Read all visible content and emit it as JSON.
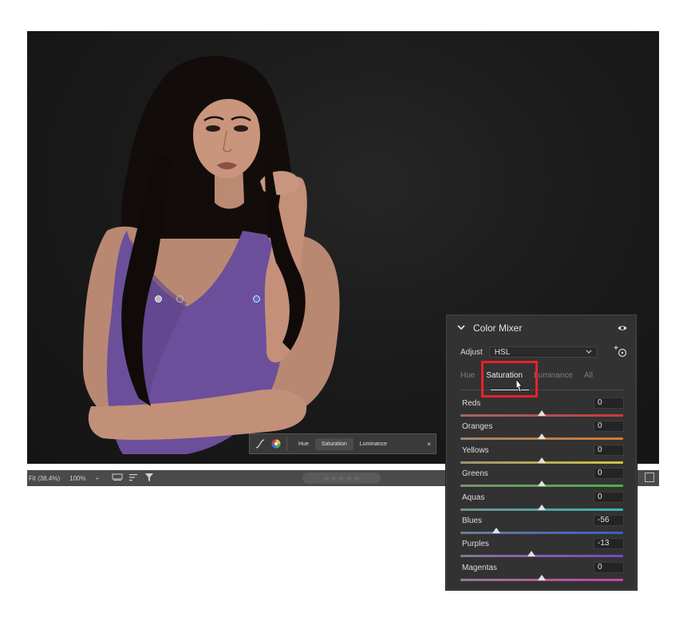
{
  "mini_toolbar": {
    "tabs": [
      "Hue",
      "Saturation",
      "Luminance"
    ],
    "active_tab": "Saturation",
    "close": "×"
  },
  "bottom_bar": {
    "fit": "Fit (38.4%)",
    "zoom": "100%",
    "zoom_sep": "÷",
    "stars": "☆ ☆ ☆ ☆ ☆"
  },
  "panel": {
    "title": "Color Mixer",
    "adjust_label": "Adjust",
    "adjust_value": "HSL",
    "tabs": [
      "Hue",
      "Saturation",
      "Luminance",
      "All"
    ],
    "active_tab": "Saturation",
    "sliders": [
      {
        "label": "Reds",
        "value": "0",
        "fraction": 0.5,
        "track_colors": [
          "#9e6a6a",
          "#c43b3b"
        ]
      },
      {
        "label": "Oranges",
        "value": "0",
        "fraction": 0.5,
        "track_colors": [
          "#9c8470",
          "#d07a33"
        ]
      },
      {
        "label": "Yellows",
        "value": "0",
        "fraction": 0.5,
        "track_colors": [
          "#9a9470",
          "#cfc23d"
        ]
      },
      {
        "label": "Greens",
        "value": "0",
        "fraction": 0.5,
        "track_colors": [
          "#7a8f75",
          "#4caf45"
        ]
      },
      {
        "label": "Aquas",
        "value": "0",
        "fraction": 0.5,
        "track_colors": [
          "#72908e",
          "#3cb3b0"
        ]
      },
      {
        "label": "Blues",
        "value": "-56",
        "fraction": 0.22,
        "track_colors": [
          "#707b95",
          "#3b5cc8"
        ]
      },
      {
        "label": "Purples",
        "value": "-13",
        "fraction": 0.435,
        "track_colors": [
          "#857895",
          "#7a45c2"
        ]
      },
      {
        "label": "Magentas",
        "value": "0",
        "fraction": 0.5,
        "track_colors": [
          "#957b90",
          "#c443a8"
        ]
      }
    ]
  }
}
